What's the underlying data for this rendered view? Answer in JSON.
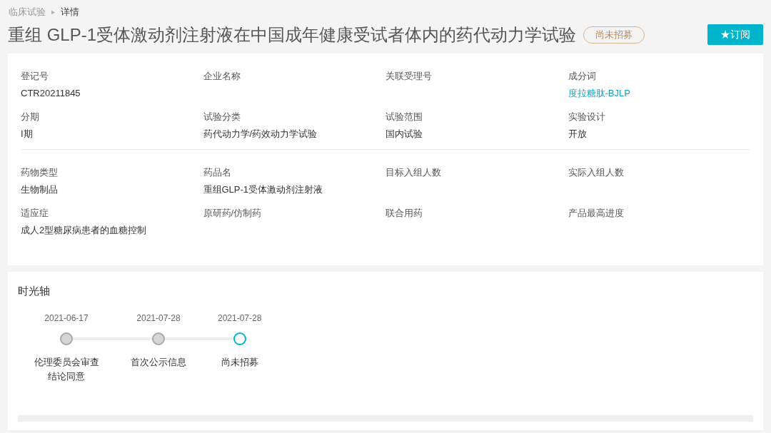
{
  "breadcrumb": {
    "parent": "临床试验",
    "separator": "▸",
    "current": "详情"
  },
  "title": "重组 GLP-1受体激动剂注射液在中国成年健康受试者体内的药代动力学试验",
  "status_badge": "尚未招募",
  "subscribe_button": "★订阅",
  "field_groups": [
    [
      {
        "label": "登记号",
        "value": "CTR20211845",
        "kind": "text"
      },
      {
        "label": "企业名称"
      },
      {
        "label": "关联受理号"
      },
      {
        "label": "成分词",
        "value": "度拉糖肽-BJLP",
        "kind": "link"
      },
      {
        "label": "分期",
        "value": "I期",
        "kind": "text"
      },
      {
        "label": "试验分类",
        "value": "药代动力学/药效动力学试验",
        "kind": "text"
      },
      {
        "label": "试验范围",
        "value": "国内试验",
        "kind": "text"
      },
      {
        "label": "实验设计",
        "value": "开放",
        "kind": "text"
      }
    ],
    [
      {
        "label": "药物类型",
        "value": "生物制品",
        "kind": "text"
      },
      {
        "label": "药品名",
        "value": "重组GLP-1受体激动剂注射液",
        "kind": "text"
      },
      {
        "label": "目标入组人数"
      },
      {
        "label": "实际入组人数"
      },
      {
        "label": "适应症",
        "value": "成人2型糖尿病患者的血糖控制",
        "kind": "text"
      },
      {
        "label": "原研药/仿制药"
      },
      {
        "label": "联合用药"
      },
      {
        "label": "产品最高进度"
      }
    ]
  ],
  "timeline": {
    "title": "时光轴",
    "events": [
      {
        "date": "2021-06-17",
        "label": "伦理委员会审查结论同意",
        "current": false
      },
      {
        "date": "2021-07-28",
        "label": "首次公示信息",
        "current": false
      },
      {
        "date": "2021-07-28",
        "label": "尚未招募",
        "current": true
      }
    ]
  }
}
